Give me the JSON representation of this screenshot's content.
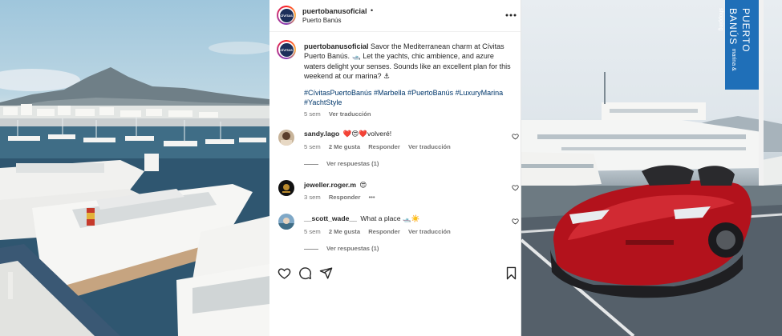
{
  "post": {
    "username": "puertobanusoficial",
    "dot": "•",
    "location": "Puerto Banús",
    "avatar_text": "CÍVITAS",
    "caption_text": "Savor the Mediterranean charm at Cívitas Puerto Banús. 🛥️ Let the yachts, chic ambience, and azure waters delight your senses. Sounds like an excellent plan for this weekend at our marina? ⚓",
    "hashtags": "#CívitasPuertoBanús #Marbella #PuertoBanús #LuxuryMarina #YachtStyle",
    "age": "5 sem",
    "translate": "Ver traducción"
  },
  "comments": [
    {
      "username": "sandy.lago",
      "text": "❤️😍❤️volveré!",
      "age": "5 sem",
      "likes": "2 Me gusta",
      "reply": "Responder",
      "translate": "Ver traducción",
      "replies": "Ver respuestas (1)"
    },
    {
      "username": "jeweller.roger.m",
      "text": "😍",
      "age": "3 sem",
      "reply": "Responder",
      "more": "•••"
    },
    {
      "username": "__scott_wade__",
      "text": "What a place 🛥️☀️",
      "age": "5 sem",
      "likes": "2 Me gusta",
      "reply": "Responder",
      "translate": "Ver traducción",
      "replies": "Ver respuestas (1)"
    }
  ],
  "banner": {
    "line1": "PUERTO BANÚS",
    "line2": "marina & shopping"
  },
  "icons": {
    "more": "more-horizontal-icon",
    "like": "heart-icon",
    "comment": "comment-icon",
    "share": "send-icon",
    "save": "bookmark-icon"
  },
  "colors": {
    "text": "#262626",
    "muted": "#737373",
    "hashtag": "#00376b",
    "banner": "#1f6fb8",
    "car": "#b3121c"
  }
}
